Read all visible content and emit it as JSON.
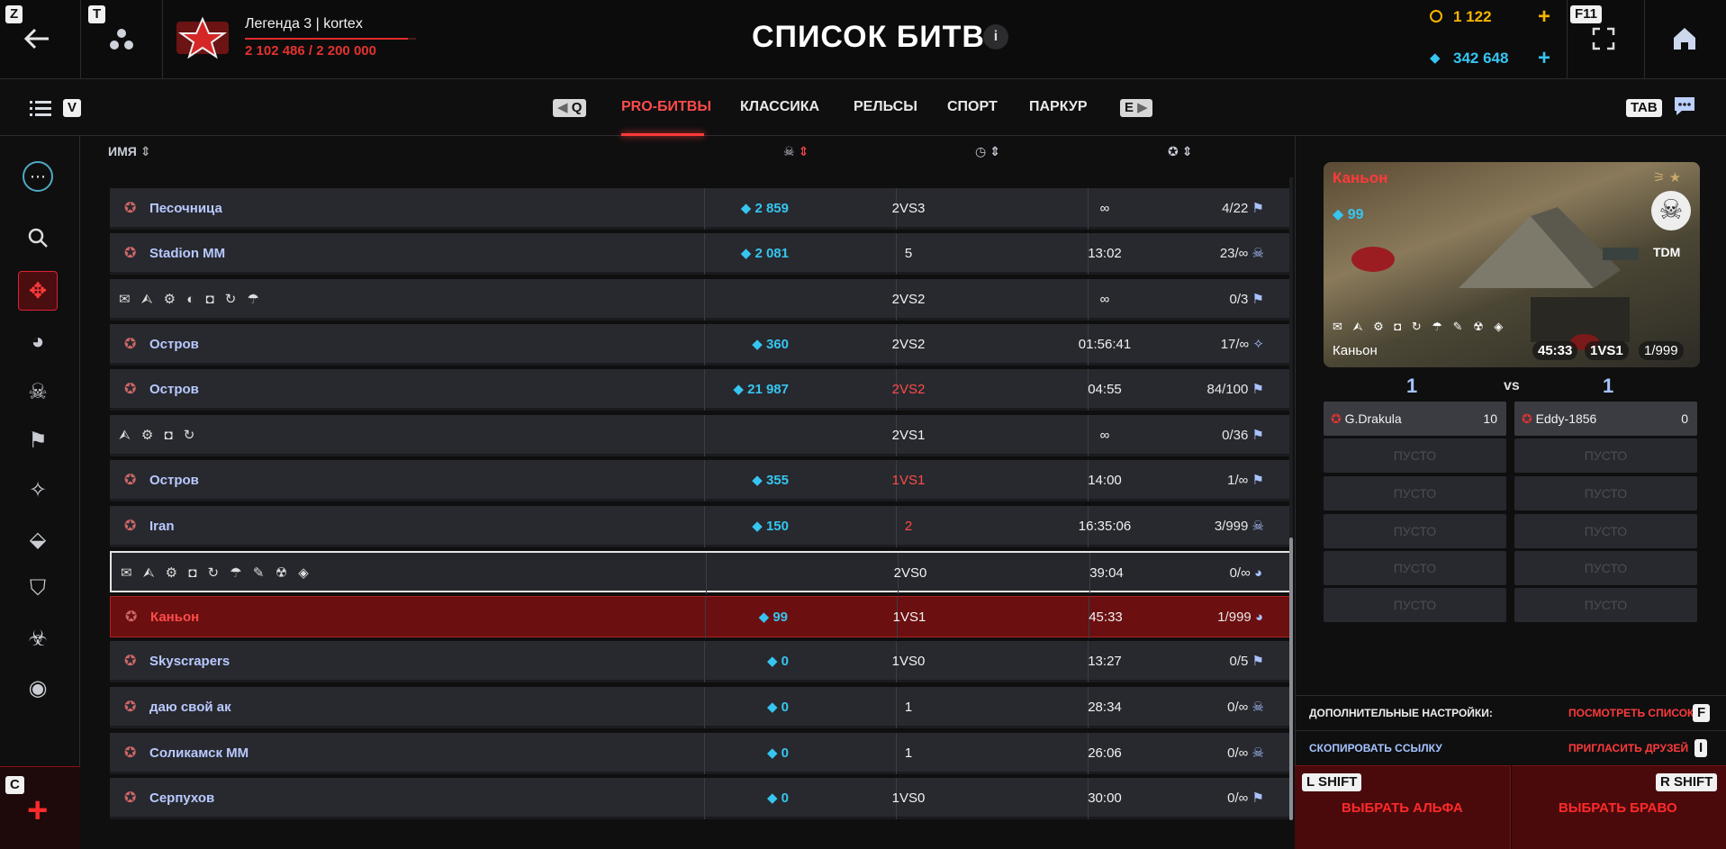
{
  "keys": {
    "back": "Z",
    "friends": "T",
    "fullscreen": "F11",
    "list": "V",
    "prev": "Q",
    "next": "E",
    "chat": "TAB",
    "create": "C",
    "advanced": "F",
    "invite": "I",
    "alpha": "L SHIFT",
    "bravo": "R SHIFT"
  },
  "player": {
    "rank": "Легенда 3",
    "name": "kortex",
    "xp": "2 102 486 / 2 200 000",
    "xp_fraction": 0.955
  },
  "title": "СПИСОК БИТВ",
  "info": "i",
  "currency": {
    "crystals_gold": "1 122",
    "crystals": "342 648"
  },
  "tabs": [
    "PRO-БИТВЫ",
    "КЛАССИКА",
    "РЕЛЬСЫ",
    "СПОРТ",
    "ПАРКУР"
  ],
  "header": {
    "name": "ИМЯ"
  },
  "battles": [
    {
      "name": "Песочница",
      "crystals": "2 859",
      "mode": "2VS3",
      "time": "∞",
      "score": "4/22"
    },
    {
      "name": "Stadion MM",
      "crystals": "2 081",
      "mode": "5",
      "time": "13:02",
      "score": "23/∞"
    },
    {
      "name": "",
      "crystals": "",
      "mode": "2VS2",
      "time": "∞",
      "score": "0/3",
      "flags": "✉ ⮙ ⚙ ◐ ◘ ↻ ☂"
    },
    {
      "name": "Остров",
      "crystals": "360",
      "mode": "2VS2",
      "time": "01:56:41",
      "score": "17/∞"
    },
    {
      "name": "Остров",
      "crystals": "21 987",
      "mode": "2VS2",
      "time": "04:55",
      "score": "84/100",
      "mode_red": true
    },
    {
      "name": "",
      "crystals": "",
      "mode": "2VS1",
      "time": "∞",
      "score": "0/36",
      "flags": "⮙ ⚙ ◘ ↻"
    },
    {
      "name": "Остров",
      "crystals": "355",
      "mode": "1VS1",
      "time": "14:00",
      "score": "1/∞",
      "mode_red": true
    },
    {
      "name": "Iran",
      "crystals": "150",
      "mode": "2",
      "time": "16:35:06",
      "score": "3/999",
      "mode_red": true
    },
    {
      "name": "",
      "crystals": "",
      "mode": "2VS0",
      "time": "39:04",
      "score": "0/∞",
      "flags": "✉ ⮙ ⚙ ◘ ↻ ☂ ✎ ☢ ◈"
    },
    {
      "name": "Каньон",
      "crystals": "99",
      "mode": "1VS1",
      "time": "45:33",
      "score": "1/999"
    },
    {
      "name": "Skyscrapers",
      "crystals": "0",
      "mode": "1VS0",
      "time": "13:27",
      "score": "0/5"
    },
    {
      "name": "даю свой ак",
      "crystals": "0",
      "mode": "1",
      "time": "28:34",
      "score": "0/∞"
    },
    {
      "name": "Соликамск ММ",
      "crystals": "0",
      "mode": "1",
      "time": "26:06",
      "score": "0/∞"
    },
    {
      "name": "Серпухов",
      "crystals": "0",
      "mode": "1VS0",
      "time": "30:00",
      "score": "0/∞"
    }
  ],
  "preview": {
    "map": "Каньон",
    "crystals": "99",
    "mode": "TDM",
    "map_bottom": "Каньон",
    "time": "45:33",
    "format": "1VS1",
    "score": "1/999",
    "flags": "✉ ⮙ ⚙ ◘ ↻ ☂ ✎ ☢ ◈"
  },
  "teams": {
    "alpha_count": "1",
    "vs": "vs",
    "bravo_count": "1",
    "alpha_player": "G.Drakula",
    "alpha_score": "10",
    "bravo_player": "Eddy-1856",
    "bravo_score": "0",
    "empty": "ПУСТО"
  },
  "bottom": {
    "advanced": "ДОПОЛНИТЕЛЬНЫЕ НАСТРОЙКИ:",
    "view_list": "ПОСМОТРЕТЬ СПИСОК",
    "copy_link": "СКОПИРОВАТЬ ССЫЛКУ",
    "invite": "ПРИГЛАСИТЬ ДРУЗЕЙ",
    "alpha": "ВЫБРАТЬ АЛЬФА",
    "bravo": "ВЫБРАТЬ БРАВО"
  }
}
